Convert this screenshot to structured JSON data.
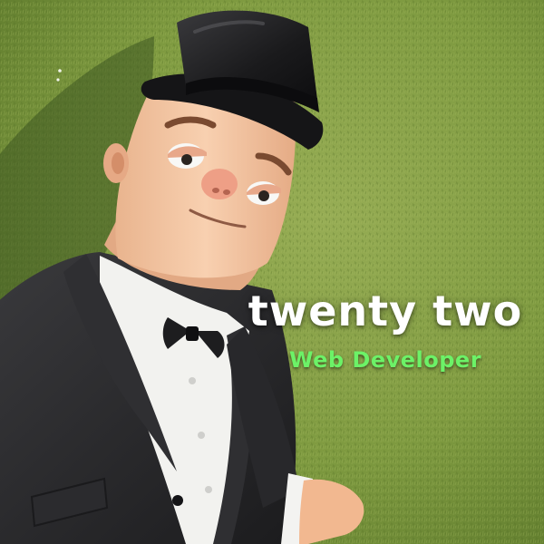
{
  "hero": {
    "title": "twenty two",
    "subtitle": "Web Developer"
  },
  "colors": {
    "grass_light": "#8fa64a",
    "grass_dark": "#5d7a2c",
    "skin": "#f2c09a",
    "suit": "#2a2a2c",
    "shirt": "#f4f4f2",
    "hat": "#1b1b1d",
    "subtitle_green": "#6cf267",
    "title_white": "#ffffff"
  }
}
